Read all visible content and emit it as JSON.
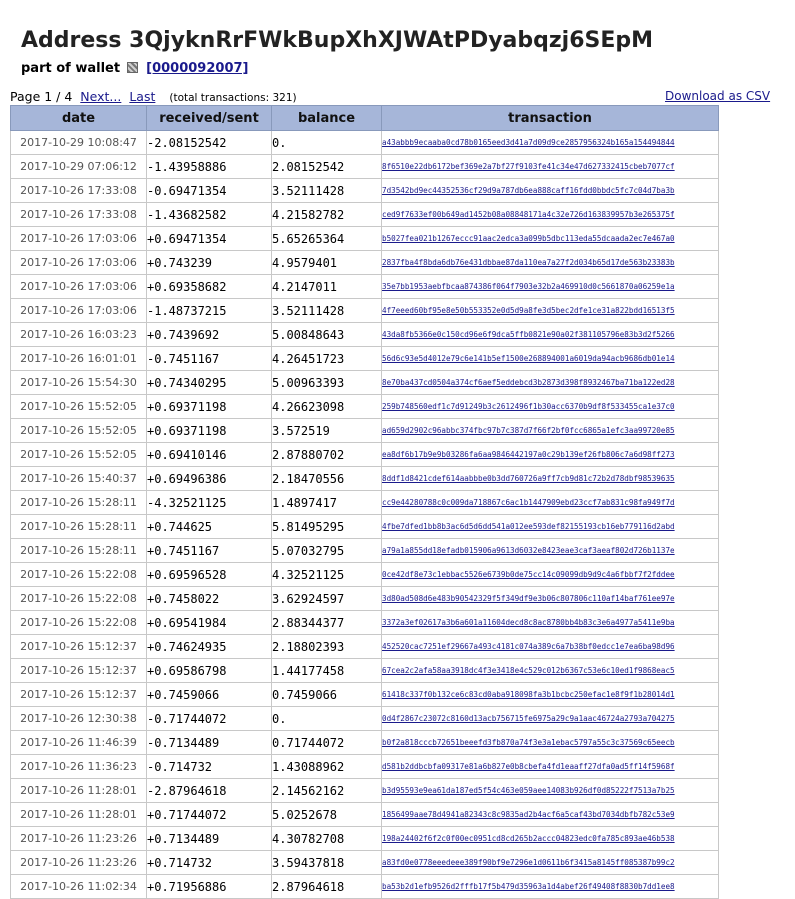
{
  "header": {
    "title": "Address 3QjyknRrFWkBupXhXJWAtPDyabqzj6SEpM",
    "wallet_prefix": "part of wallet",
    "wallet_id": "[0000092007]"
  },
  "pager": {
    "page_text": "Page 1 / 4",
    "next_label": "Next...",
    "last_label": "Last",
    "total_text": "(total transactions: 321)"
  },
  "download_label": "Download as CSV",
  "table": {
    "headers": [
      "date",
      "received/sent",
      "balance",
      "transaction"
    ],
    "rows": [
      {
        "date": "2017-10-29 10:08:47",
        "amount": "-2.08152542",
        "balance": "0.",
        "tx": "a43abbb9ecaaba0cd78b0165eed3d41a7d09d9ce2857956324b165a154494844"
      },
      {
        "date": "2017-10-29 07:06:12",
        "amount": "-1.43958886",
        "balance": "2.08152542",
        "tx": "8f6510e22db6172bef369e2a7bf27f9103fe41c34e47d627332415cbeb7077cf"
      },
      {
        "date": "2017-10-26 17:33:08",
        "amount": "-0.69471354",
        "balance": "3.52111428",
        "tx": "7d3542bd9ec44352536cf29d9a787db6ea888caff16fdd0bbdc5fc7c04d7ba3b"
      },
      {
        "date": "2017-10-26 17:33:08",
        "amount": "-1.43682582",
        "balance": "4.21582782",
        "tx": "ced9f7633ef00b649ad1452b08a08848171a4c32e726d163839957b3e265375f"
      },
      {
        "date": "2017-10-26 17:03:06",
        "amount": "+0.69471354",
        "balance": "5.65265364",
        "tx": "b5027fea021b1267eccc91aac2edca3a099b5dbc113eda55dcaada2ec7e467a0"
      },
      {
        "date": "2017-10-26 17:03:06",
        "amount": "+0.743239",
        "balance": "4.9579401",
        "tx": "2837fba4f8bda6db76e431dbbae87da110ea7a27f2d034b65d17de563b23383b"
      },
      {
        "date": "2017-10-26 17:03:06",
        "amount": "+0.69358682",
        "balance": "4.2147011",
        "tx": "35e7bb1953aebfbcaa874386f064f7903e32b2a469910d0c5661870a06259e1a"
      },
      {
        "date": "2017-10-26 17:03:06",
        "amount": "-1.48737215",
        "balance": "3.52111428",
        "tx": "4f7eeed60bf95e8e50b553352e0d5d9a8fe3d5bec2dfe1ce31a822bdd16513f5"
      },
      {
        "date": "2017-10-26 16:03:23",
        "amount": "+0.7439692",
        "balance": "5.00848643",
        "tx": "43da8fb5366e0c150cd96e6f9dca5ffb0821e90a02f381105796e83b3d2f5266"
      },
      {
        "date": "2017-10-26 16:01:01",
        "amount": "-0.7451167",
        "balance": "4.26451723",
        "tx": "56d6c93e5d4012e79c6e141b5ef1500e268894001a6019da94acb9686db01e14"
      },
      {
        "date": "2017-10-26 15:54:30",
        "amount": "+0.74340295",
        "balance": "5.00963393",
        "tx": "8e70ba437cd0504a374cf6aef5eddebcd3b2873d398f8932467ba71ba122ed28"
      },
      {
        "date": "2017-10-26 15:52:05",
        "amount": "+0.69371198",
        "balance": "4.26623098",
        "tx": "259b748560edf1c7d91249b3c2612496f1b30acc6370b9df8f533455ca1e37c0"
      },
      {
        "date": "2017-10-26 15:52:05",
        "amount": "+0.69371198",
        "balance": "3.572519",
        "tx": "ad659d2902c96abbc374fbc97b7c387d7f66f2bf0fcc6865a1efc3aa99720e85"
      },
      {
        "date": "2017-10-26 15:52:05",
        "amount": "+0.69410146",
        "balance": "2.87880702",
        "tx": "ea8df6b17b9e9b03286fa6aa9846442197a0c29b139ef26fb806c7a6d98ff273"
      },
      {
        "date": "2017-10-26 15:40:37",
        "amount": "+0.69496386",
        "balance": "2.18470556",
        "tx": "8ddf1d8421cdef614aabbbe0b3dd760726a9ff7cb9d81c72b2d78dbf98539635"
      },
      {
        "date": "2017-10-26 15:28:11",
        "amount": "-4.32521125",
        "balance": "1.4897417",
        "tx": "cc9e44280788c0c009da718867c6ac1b1447909ebd23ccf7ab831c98fa949f7d"
      },
      {
        "date": "2017-10-26 15:28:11",
        "amount": "+0.744625",
        "balance": "5.81495295",
        "tx": "4fbe7dfed1bb8b3ac6d5d6dd541a012ee593def82155193cb16eb779116d2abd"
      },
      {
        "date": "2017-10-26 15:28:11",
        "amount": "+0.7451167",
        "balance": "5.07032795",
        "tx": "a79a1a855dd18efadb015906a9613d6032e8423eae3caf3aeaf802d726b1137e"
      },
      {
        "date": "2017-10-26 15:22:08",
        "amount": "+0.69596528",
        "balance": "4.32521125",
        "tx": "0ce42df8e73c1ebbac5526e6739b0de75cc14c09099db9d9c4a6fbbf7f2fddee"
      },
      {
        "date": "2017-10-26 15:22:08",
        "amount": "+0.7458022",
        "balance": "3.62924597",
        "tx": "3d80ad508d6e483b90542329f5f349df9e3b06c807806c110af14baf761ee97e"
      },
      {
        "date": "2017-10-26 15:22:08",
        "amount": "+0.69541984",
        "balance": "2.88344377",
        "tx": "3372a3ef02617a3b6a601a11604decd8c8ac8780bb4b83c3e6a4977a5411e9ba"
      },
      {
        "date": "2017-10-26 15:12:37",
        "amount": "+0.74624935",
        "balance": "2.18802393",
        "tx": "452520cac7251ef29667a493c4181c074a389c6a7b38bf0edcc1e7ea6ba98d96"
      },
      {
        "date": "2017-10-26 15:12:37",
        "amount": "+0.69586798",
        "balance": "1.44177458",
        "tx": "67cea2c2afa58aa3918dc4f3e3418e4c529c012b6367c53e6c10ed1f9868eac5"
      },
      {
        "date": "2017-10-26 15:12:37",
        "amount": "+0.7459066",
        "balance": "0.7459066",
        "tx": "61418c337f0b132ce6c83cd0aba918098fa3b1bcbc250efac1e8f9f1b28014d1"
      },
      {
        "date": "2017-10-26 12:30:38",
        "amount": "-0.71744072",
        "balance": "0.",
        "tx": "0d4f2867c23072c8160d13acb756715fe6975a29c9a1aac46724a2793a704275"
      },
      {
        "date": "2017-10-26 11:46:39",
        "amount": "-0.7134489",
        "balance": "0.71744072",
        "tx": "b0f2a818cccb72651beeefd3fb870a74f3e3a1ebac5797a55c3c37569c65eecb"
      },
      {
        "date": "2017-10-26 11:36:23",
        "amount": "-0.714732",
        "balance": "1.43088962",
        "tx": "d581b2ddbcbfa09317e81a6b827e0b8cbefa4fd1eaaff27dfa0ad5ff14f5968f"
      },
      {
        "date": "2017-10-26 11:28:01",
        "amount": "-2.87964618",
        "balance": "2.14562162",
        "tx": "b3d95593e9ea61da187ed5f54c463e059aee14083b926df0d85222f7513a7b25"
      },
      {
        "date": "2017-10-26 11:28:01",
        "amount": "+0.71744072",
        "balance": "5.0252678",
        "tx": "1856499aae78d4941a82343c8c9835ad2b4acf6a5caf43bd7034dbfb782c53e9"
      },
      {
        "date": "2017-10-26 11:23:26",
        "amount": "+0.7134489",
        "balance": "4.30782708",
        "tx": "198a24402f6f2c0f00ec0951cd8cd265b2accc04823edc0fa785c893ae46b538"
      },
      {
        "date": "2017-10-26 11:23:26",
        "amount": "+0.714732",
        "balance": "3.59437818",
        "tx": "a83fd0e0778eeedeee389f90bf9e7296e1d0611b6f3415a8145ff085387b99c2"
      },
      {
        "date": "2017-10-26 11:02:34",
        "amount": "+0.71956886",
        "balance": "2.87964618",
        "tx": "ba53b2d1efb9526d2fffb17f5b479d35963a1d4abef26f49408f8830b7dd1ee8"
      }
    ]
  }
}
